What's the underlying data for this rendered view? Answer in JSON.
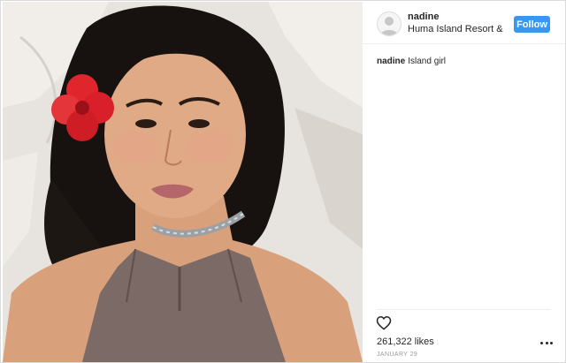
{
  "post": {
    "username": "nadine",
    "location": "Huma Island Resort & S...",
    "follow_label": "Follow",
    "caption_text": "Island girl",
    "likes_count": "261,322",
    "likes_word": "likes",
    "date": "JANUARY 29"
  },
  "colors": {
    "follow_button": "#3897f0",
    "text": "#262626",
    "muted": "#999999"
  },
  "icons": {
    "avatar": "default-user-avatar-icon",
    "like": "heart-outline-icon",
    "more": "ellipsis-icon"
  }
}
